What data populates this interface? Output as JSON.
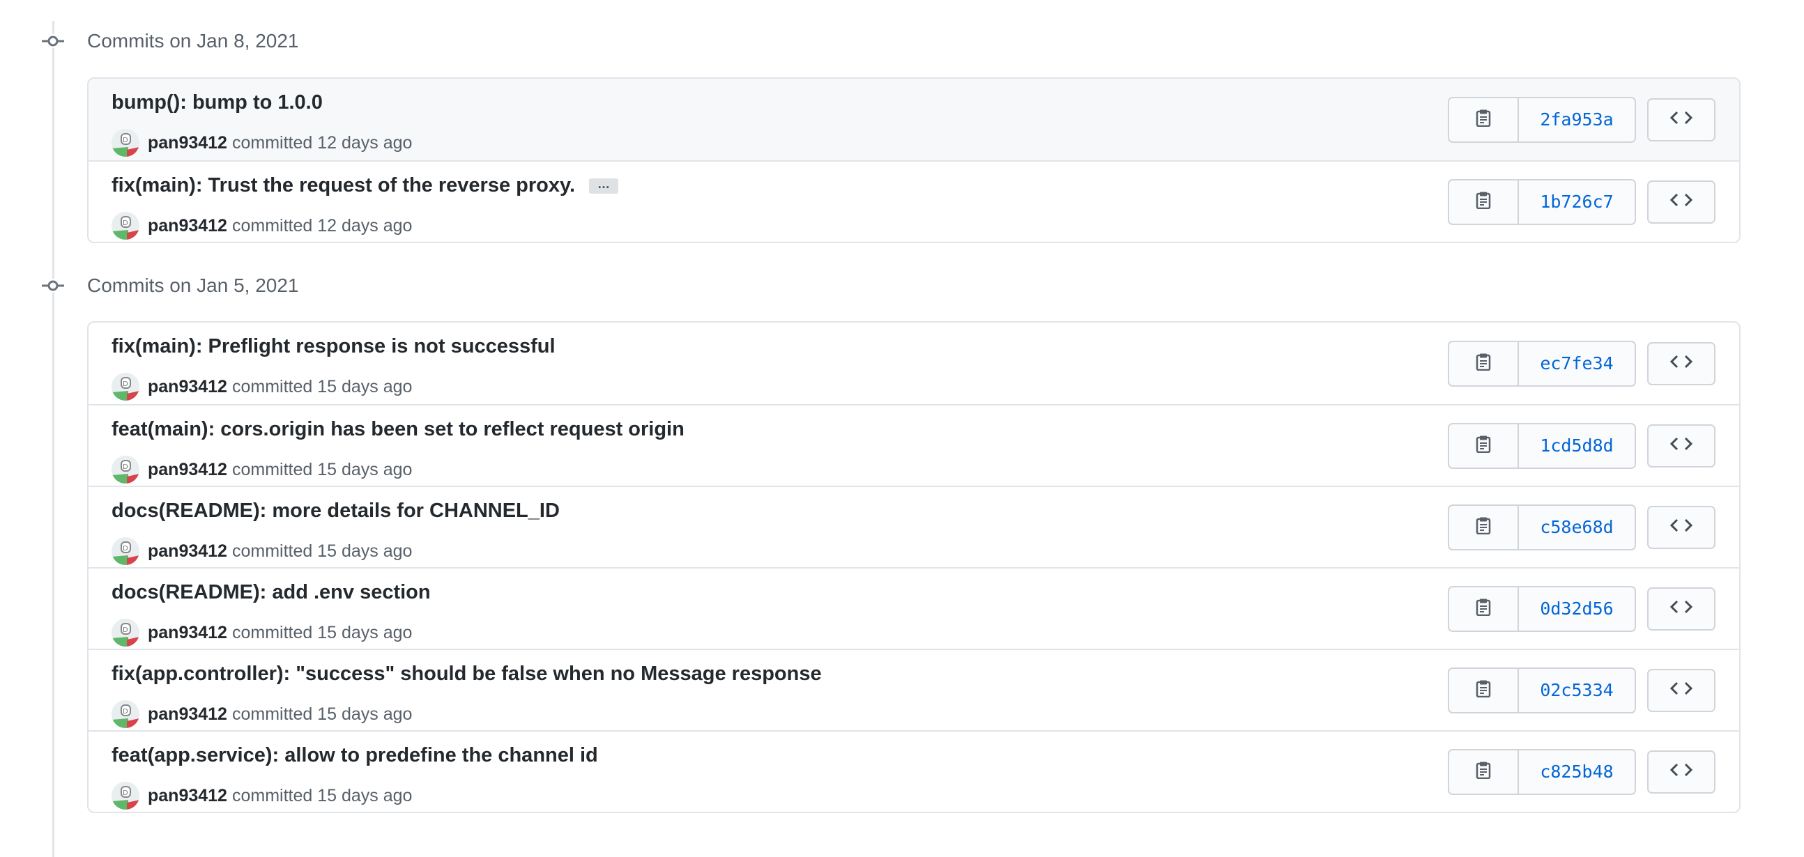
{
  "groups": [
    {
      "title": "Commits on Jan 8, 2021",
      "commits": [
        {
          "message": "bump(): bump to 1.0.0",
          "author": "pan93412",
          "time": "committed 12 days ago",
          "sha": "2fa953a",
          "has_ellipsis": false
        },
        {
          "message": "fix(main): Trust the request of the reverse proxy.",
          "author": "pan93412",
          "time": "committed 12 days ago",
          "sha": "1b726c7",
          "has_ellipsis": true,
          "ellipsis": "…"
        }
      ]
    },
    {
      "title": "Commits on Jan 5, 2021",
      "commits": [
        {
          "message": "fix(main): Preflight response is not successful",
          "author": "pan93412",
          "time": "committed 15 days ago",
          "sha": "ec7fe34"
        },
        {
          "message": "feat(main): cors.origin has been set to reflect request origin",
          "author": "pan93412",
          "time": "committed 15 days ago",
          "sha": "1cd5d8d"
        },
        {
          "message": "docs(README): more details for CHANNEL_ID",
          "author": "pan93412",
          "time": "committed 15 days ago",
          "sha": "c58e68d"
        },
        {
          "message": "docs(README): add .env section",
          "author": "pan93412",
          "time": "committed 15 days ago",
          "sha": "0d32d56"
        },
        {
          "message": "fix(app.controller): \"success\" should be false when no Message response",
          "author": "pan93412",
          "time": "committed 15 days ago",
          "sha": "02c5334"
        },
        {
          "message": "feat(app.service): allow to predefine the channel id",
          "author": "pan93412",
          "time": "committed 15 days ago",
          "sha": "c825b48"
        }
      ]
    }
  ],
  "icons": {
    "timeline_node": "git-commit-icon",
    "copy": "clipboard-icon",
    "browse": "code-icon",
    "avatar": "user-avatar"
  },
  "colors": {
    "sha_link": "#0366d6",
    "border": "#e1e4e8",
    "muted_text": "#586069",
    "highlight_row": "#f6f8fa"
  }
}
